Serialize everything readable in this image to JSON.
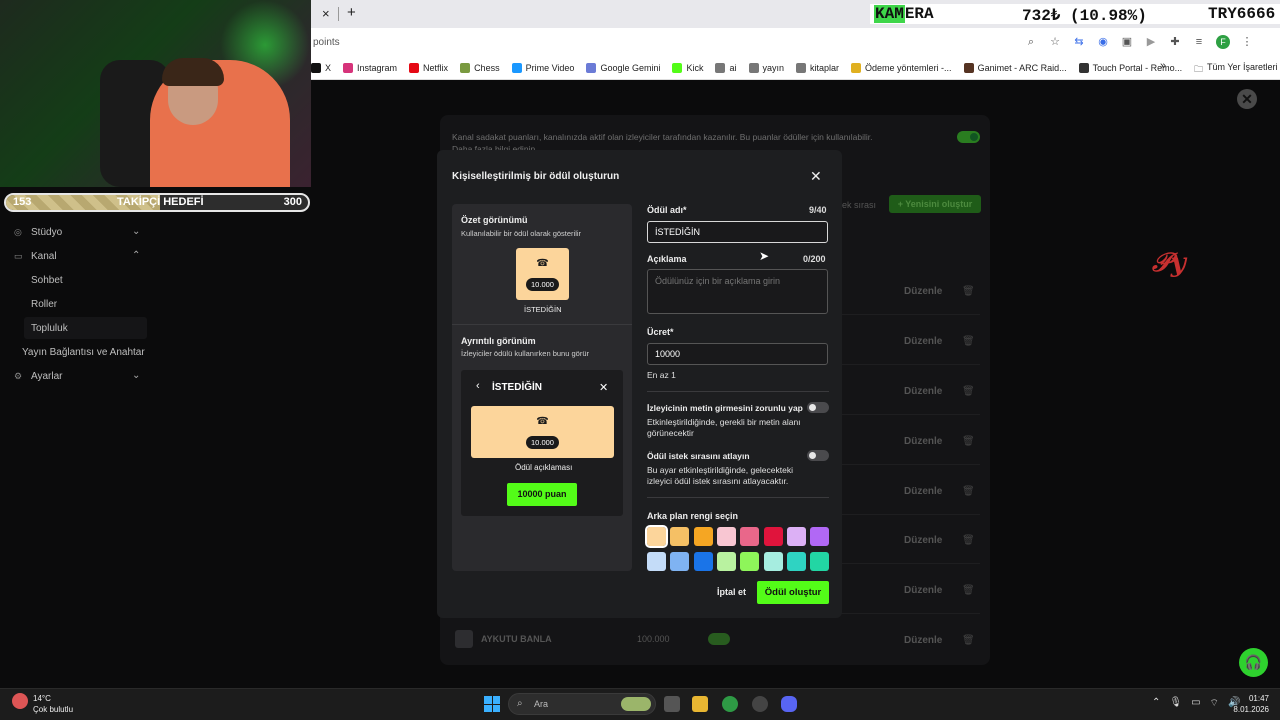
{
  "browser": {
    "tab_close": "×",
    "new_tab": "+",
    "address_partial": "points",
    "bookmarks": [
      {
        "label": "X",
        "color": "#111111"
      },
      {
        "label": "Instagram",
        "color": "#d6337a"
      },
      {
        "label": "Netflix",
        "color": "#e50914"
      },
      {
        "label": "Chess",
        "color": "#7a9a40"
      },
      {
        "label": "Prime Video",
        "color": "#1a98ff"
      },
      {
        "label": "Google Gemini",
        "color": "#6b7bd6"
      },
      {
        "label": "Kick",
        "color": "#53fc18"
      },
      {
        "label": "ai",
        "color": "#777777"
      },
      {
        "label": "yayın",
        "color": "#777777"
      },
      {
        "label": "kitaplar",
        "color": "#777777"
      },
      {
        "label": "Ödeme yöntemleri -...",
        "color": "#e0b020"
      },
      {
        "label": "Ganimet - ARC Raid...",
        "color": "#553322"
      },
      {
        "label": "Touch Portal - Remo...",
        "color": "#333333"
      }
    ],
    "bookmarks_more": "»",
    "all_bookmarks": "Tüm Yer İşaretleri",
    "profile_initial": "F"
  },
  "ticker": {
    "symbol_highlight": "KAM",
    "symbol_rest": "ERA",
    "price": "732₺ (10.98%)",
    "currency": "TRY6666"
  },
  "stream_overlay": {
    "goal_current": "153",
    "goal_label": "TAKİPÇİ HEDEFİ",
    "goal_target": "300",
    "goal_progress": 0.51
  },
  "sidebar": {
    "items": [
      {
        "label": "Stüdyo",
        "icon": "studio-icon"
      },
      {
        "label": "Kanal",
        "icon": "channel-icon"
      },
      {
        "label": "Sohbet"
      },
      {
        "label": "Roller"
      },
      {
        "label": "Topluluk"
      },
      {
        "label": "Yayın Bağlantısı ve Anahtar"
      },
      {
        "label": "Ayarlar",
        "icon": "gear-icon"
      }
    ]
  },
  "background_page": {
    "intro_text": "Kanal sadakat puanları, kanalınızda aktif olan izleyiciler tarafından kazanılır. Bu puanlar ödüller için kullanılabilir.",
    "intro_more": "Daha fazla bilgi edinin",
    "queue_label": "ek sırası",
    "create_new": "+ Yenisini oluştur",
    "edit_label": "Düzenle",
    "last_row_name": "AYKUTU BANLA",
    "last_row_cost": "100.000"
  },
  "modal": {
    "title": "Kişiselleştirilmiş bir ödül oluşturun",
    "summary_heading": "Özet görünümü",
    "summary_sub": "Kullanılabilir bir ödül olarak gösterilir",
    "card_cost": "10.000",
    "card_name": "İSTEDİĞİN",
    "detail_heading": "Ayrıntılı görünüm",
    "detail_sub": "İzleyiciler ödülü kullanırken bunu görür",
    "detail_title": "İSTEDİĞİN",
    "detail_desc": "Ödül açıklaması",
    "detail_button": "10000 puan",
    "name_label": "Ödül adı*",
    "name_count": "9/40",
    "name_value": "İSTEDİĞİN",
    "desc_label": "Açıklama",
    "desc_count": "0/200",
    "desc_placeholder": "Ödülünüz için bir açıklama girin",
    "cost_label": "Ücret*",
    "cost_value": "10000",
    "cost_help": "En az 1",
    "toggle1_title": "İzleyicinin metin girmesini zorunlu yap",
    "toggle1_desc": "Etkinleştirildiğinde, gerekli bir metin alanı görünecektir",
    "toggle2_title": "Ödül istek sırasını atlayın",
    "toggle2_desc": "Bu ayar etkinleştirildiğinde, gelecekteki izleyici ödül istek sırasını atlayacaktır.",
    "color_label": "Arka plan rengi seçin",
    "colors": [
      "#fcd59b",
      "#f5c065",
      "#f5a623",
      "#f8c6d2",
      "#e9678a",
      "#e0143c",
      "#dcb0f5",
      "#b168f5",
      "#c4dcf8",
      "#7fb3f2",
      "#1a74e8",
      "#b9f2a0",
      "#8ef55a",
      "#a6ede0",
      "#2fd3c2",
      "#22d6a4"
    ],
    "cancel": "İptal et",
    "submit": "Ödül oluştur"
  },
  "taskbar": {
    "temperature": "14°C",
    "weather": "Çok bulutlu",
    "search": "Ara",
    "time": "01:47",
    "date": "8.01.2026"
  }
}
